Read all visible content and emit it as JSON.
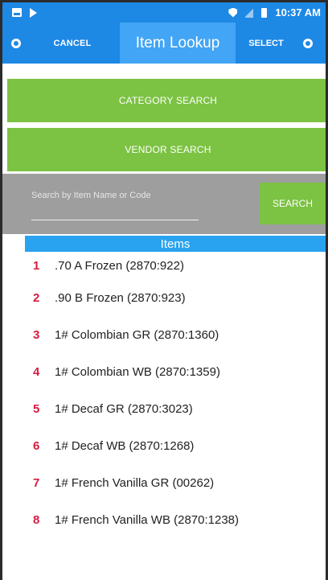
{
  "status_bar": {
    "time": "10:37 AM"
  },
  "toolbar": {
    "cancel_label": "CANCEL",
    "title": "Item Lookup",
    "select_label": "SELECT"
  },
  "buttons": {
    "category_search": "CATEGORY SEARCH",
    "vendor_search": "VENDOR SEARCH"
  },
  "search": {
    "placeholder": "Search by Item Name or Code",
    "value": "",
    "button_label": "SEARCH"
  },
  "items_header": "Items",
  "items": [
    {
      "num": "1",
      "name": ".70 A Frozen (2870:922)"
    },
    {
      "num": "2",
      "name": ".90 B Frozen (2870:923)"
    },
    {
      "num": "3",
      "name": "1# Colombian GR (2870:1360)"
    },
    {
      "num": "4",
      "name": "1# Colombian WB (2870:1359)"
    },
    {
      "num": "5",
      "name": "1# Decaf GR (2870:3023)"
    },
    {
      "num": "6",
      "name": "1# Decaf WB (2870:1268)"
    },
    {
      "num": "7",
      "name": "1# French Vanilla GR (00262)"
    },
    {
      "num": "8",
      "name": "1# French Vanilla WB (2870:1238)"
    }
  ],
  "colors": {
    "primary_blue": "#1e88e5",
    "title_blue": "#42a5f5",
    "items_header_blue": "#29a3f0",
    "green": "#7cc243",
    "search_gray": "#9e9e9e",
    "number_red": "#d81b3f"
  },
  "icons": {
    "status_left": [
      "image-icon",
      "cast-icon"
    ],
    "status_right": [
      "shield-icon",
      "signal-icon",
      "battery-icon"
    ],
    "toolbar_left": "circle-back-icon",
    "toolbar_right": "circle-forward-icon"
  }
}
